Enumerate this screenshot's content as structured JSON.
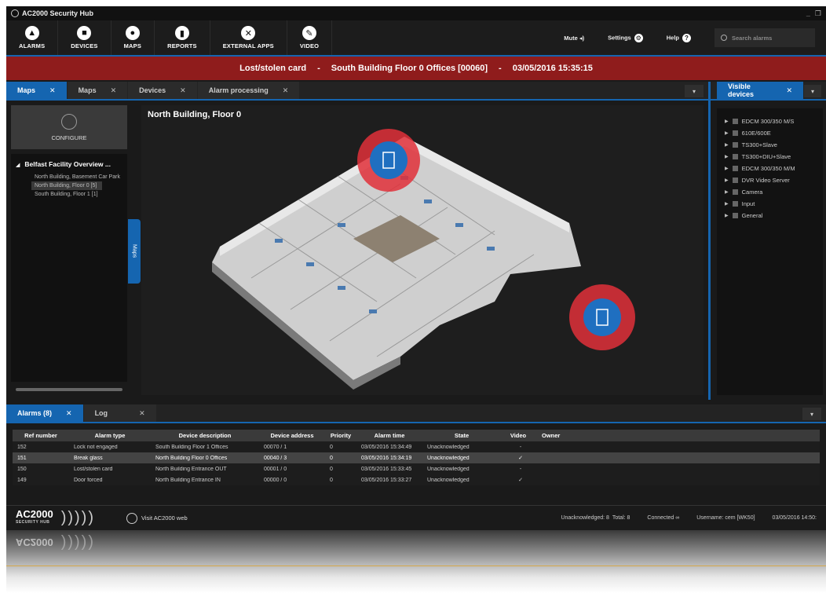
{
  "window": {
    "title": "AC2000 Security Hub"
  },
  "toolbar": {
    "items": [
      {
        "label": "ALARMS",
        "icon": "bell-icon",
        "glyph": "▲"
      },
      {
        "label": "DEVICES",
        "icon": "device-icon",
        "glyph": "■"
      },
      {
        "label": "MAPS",
        "icon": "map-icon",
        "glyph": "●"
      },
      {
        "label": "REPORTS",
        "icon": "report-icon",
        "glyph": "▮"
      },
      {
        "label": "EXTERNAL APPS",
        "icon": "apps-icon",
        "glyph": "✕"
      },
      {
        "label": "VIDEO",
        "icon": "video-icon",
        "glyph": "✎"
      }
    ],
    "mute": "Mute",
    "settings": "Settings",
    "help": "Help",
    "search_placeholder": "Search alarms"
  },
  "banner": {
    "alarm": "Lost/stolen card",
    "sep": "-",
    "location": "South Building Floor 0 Offices [00060]",
    "time": "03/05/2016 15:35:15"
  },
  "main_tabs": [
    {
      "label": "Maps",
      "active": true
    },
    {
      "label": "Maps",
      "active": false
    },
    {
      "label": "Devices",
      "active": false
    },
    {
      "label": "Alarm processing",
      "active": false
    }
  ],
  "sidebar": {
    "configure": "CONFIGURE",
    "tree_root": "Belfast Facility Overview ...",
    "tree_items": [
      "North Building, Basement Car Park",
      "North Building, Floor 0 [5]",
      "South Building, Floor 1 [1]"
    ],
    "maps_handle": "Maps"
  },
  "map": {
    "title": "North Building, Floor 0"
  },
  "right_tab": "Visible devices",
  "devices": [
    "EDCM 300/350 M/S",
    "610E/600E",
    "TS300+Slave",
    "TS300+DIU+Slave",
    "EDCM 300/350 M/M",
    "DVR Video Server",
    "Camera",
    "Input",
    "General"
  ],
  "alarm_tabs": [
    {
      "label": "Alarms (8)",
      "active": true
    },
    {
      "label": "Log",
      "active": false
    }
  ],
  "alarm_table": {
    "headers": [
      "Ref number",
      "Alarm type",
      "Device description",
      "Device address",
      "Priority",
      "Alarm time",
      "State",
      "Video",
      "Owner"
    ],
    "rows": [
      [
        "152",
        "Lock not engaged",
        "South Building Floor 1 Offices",
        "00070 / 1",
        "0",
        "03/05/2016 15:34:49",
        "Unacknowledged",
        "-",
        ""
      ],
      [
        "151",
        "Break glass",
        "North Building Floor 0 Offices",
        "00040 / 3",
        "0",
        "03/05/2016 15:34:19",
        "Unacknowledged",
        "✓",
        ""
      ],
      [
        "150",
        "Lost/stolen card",
        "North Building Entrance OUT",
        "00001 / 0",
        "0",
        "03/05/2016 15:33:45",
        "Unacknowledged",
        "-",
        ""
      ],
      [
        "149",
        "Door forced",
        "North Building Entrance IN",
        "00000 / 0",
        "0",
        "03/05/2016 15:33:27",
        "Unacknowledged",
        "✓",
        ""
      ]
    ]
  },
  "footer": {
    "brand": "AC2000",
    "brand_sub": "SECURITY HUB",
    "web_link": "Visit AC2000 web",
    "unacknowledged": "Unacknowledged: 8",
    "total": "Total: 8",
    "connected": "Connected",
    "username": "Username: cem [WK50]",
    "datetime": "03/05/2016 14:50:"
  },
  "colors": {
    "accent": "#1565b0",
    "alarm_banner": "#8f1c1c",
    "marker_red": "#e0303a"
  }
}
